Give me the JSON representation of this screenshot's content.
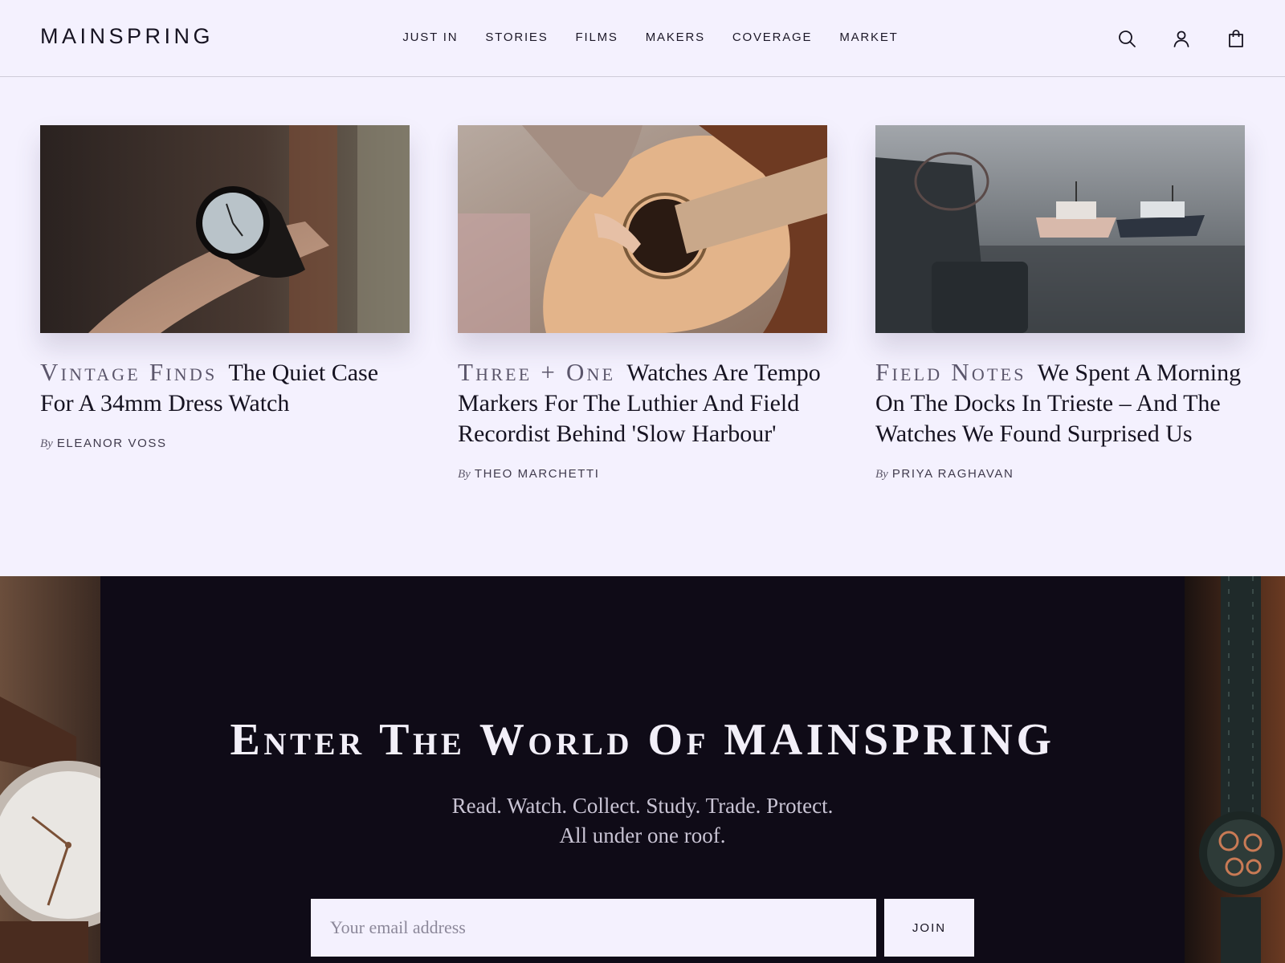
{
  "header": {
    "logo": "MAINSPRING",
    "nav": [
      "JUST IN",
      "STORIES",
      "FILMS",
      "MAKERS",
      "COVERAGE",
      "MARKET"
    ],
    "icons": [
      "search-icon",
      "account-icon",
      "shopping-bag-icon"
    ]
  },
  "articles": [
    {
      "category": "Vintage Finds",
      "title": "The Quiet Case For A 34mm Dress Watch",
      "by": "By",
      "author": "ELEANOR VOSS",
      "image": "wristwatch-on-wrist-photo"
    },
    {
      "category": "Three + One",
      "title": "Watches Are Tempo Markers For The Luthier And Field Recordist Behind 'Slow Harbour'",
      "by": "By",
      "author": "THEO MARCHETTI",
      "image": "acoustic-guitar-photo"
    },
    {
      "category": "Field Notes",
      "title": "We Spent A Morning On The Docks In Trieste – And The Watches We Found Surprised Us",
      "by": "By",
      "author": "PRIYA RAGHAVAN",
      "image": "harbour-boats-photo"
    }
  ],
  "newsletter": {
    "title": "Enter The World Of MAINSPRING",
    "subtitle_line1": "Read. Watch. Collect. Study. Trade. Protect.",
    "subtitle_line2": "All under one roof.",
    "email_placeholder": "Your email address",
    "button": "JOIN"
  },
  "colors": {
    "background": "#f4f1fe",
    "text": "#161321",
    "band_background": "#0f0b17"
  }
}
